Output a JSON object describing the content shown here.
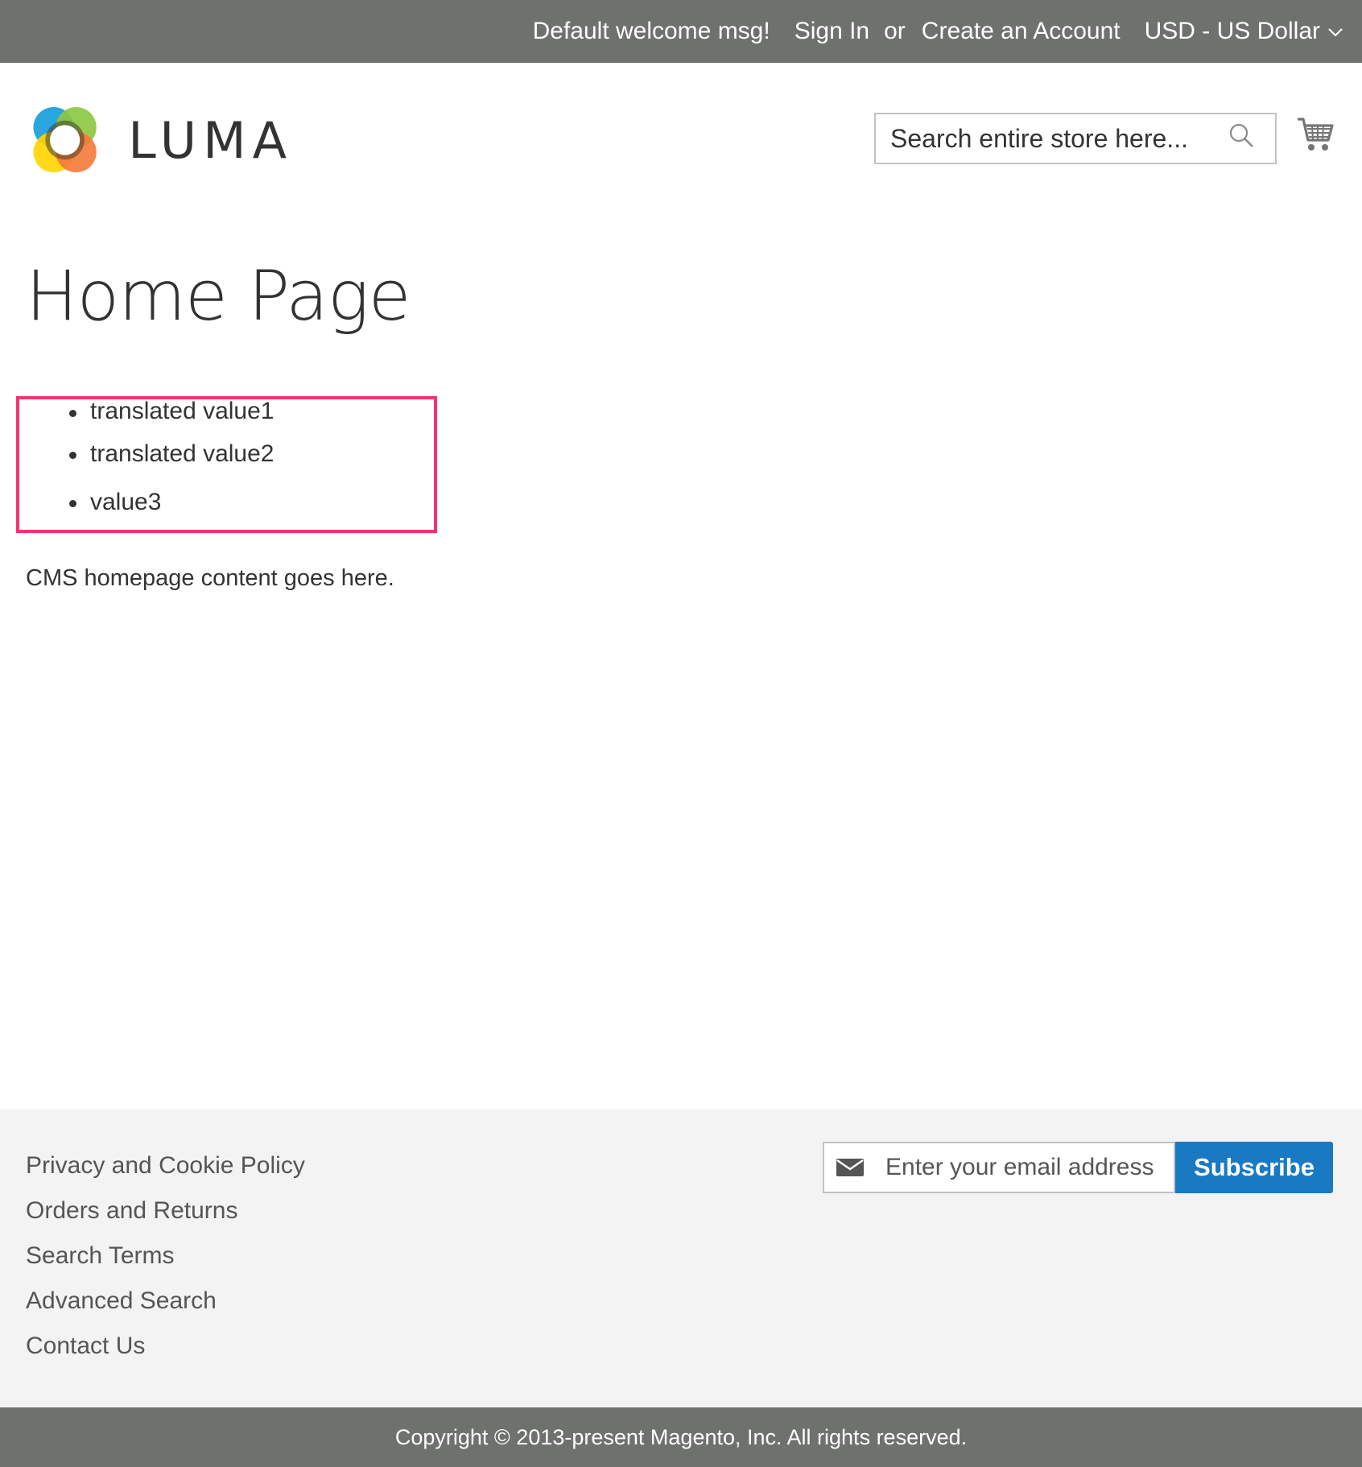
{
  "header_panel": {
    "welcome": "Default welcome msg!",
    "sign_in": "Sign In",
    "or": "or",
    "create_account": "Create an Account",
    "currency": "USD - US Dollar"
  },
  "logo": {
    "text": "LUMA"
  },
  "search": {
    "placeholder": "Search entire store here..."
  },
  "main": {
    "title": "Home Page",
    "list_items": [
      "translated value1",
      "translated value2",
      "value3"
    ],
    "cms_text": "CMS homepage content goes here."
  },
  "footer": {
    "links": [
      "Privacy and Cookie Policy",
      "Orders and Returns",
      "Search Terms",
      "Advanced Search",
      "Contact Us"
    ],
    "newsletter": {
      "placeholder": "Enter your email address",
      "button_label": "Subscribe"
    },
    "copyright": "Copyright © 2013-present Magento, Inc. All rights reserved."
  },
  "colors": {
    "top_bar": "#6e716e",
    "highlight": "#f6346f",
    "subscribe": "#1979c3",
    "footer_bg": "#f3f3f3"
  },
  "icons": [
    "chevron-down-icon",
    "luma-logo-icon",
    "search-icon",
    "cart-icon",
    "envelope-icon"
  ]
}
